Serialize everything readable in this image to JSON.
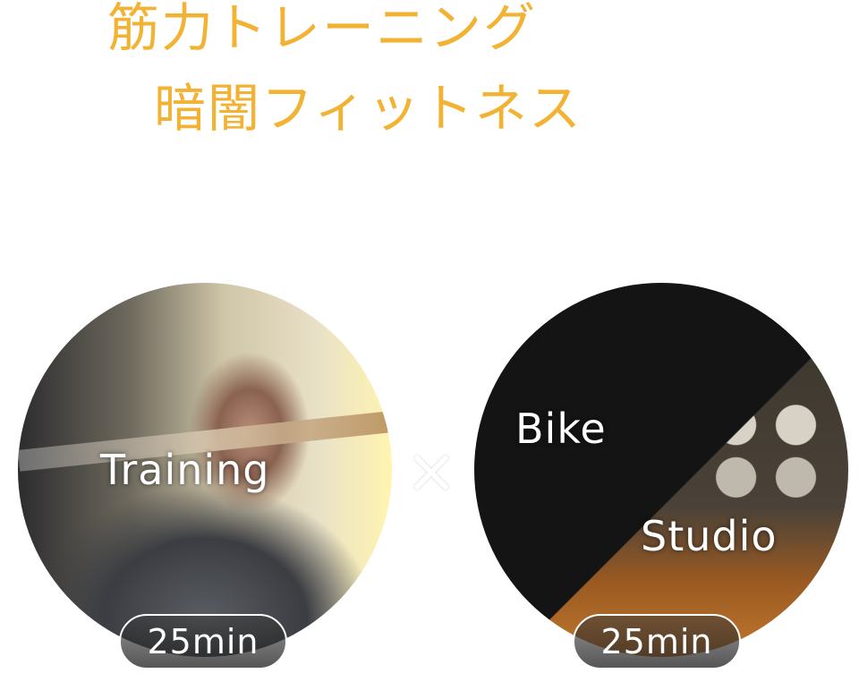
{
  "heading": {
    "line1": "筋力トレーニング",
    "line2": "暗闇フィットネス"
  },
  "programs": [
    {
      "title": "Training",
      "duration": "25min"
    },
    {
      "title_line1": "Bike",
      "title_line2": "Studio",
      "duration": "25min"
    }
  ],
  "separator": "×",
  "colors": {
    "accent": "#f2b233"
  }
}
